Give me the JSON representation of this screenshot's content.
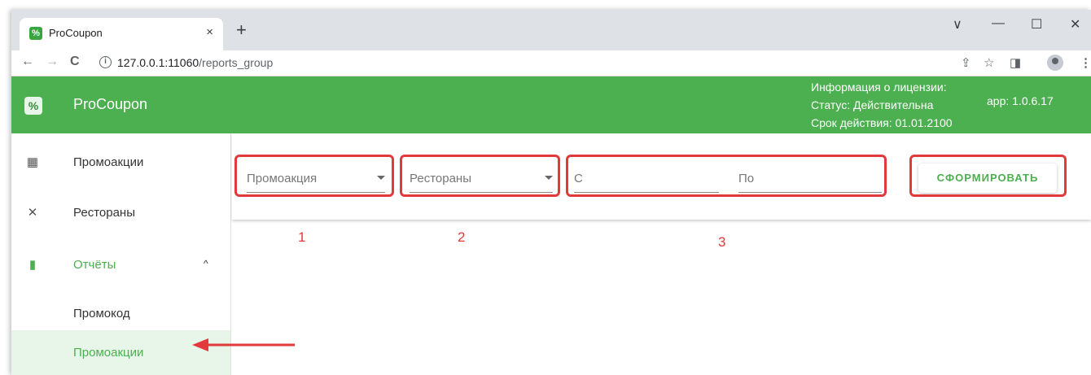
{
  "browser": {
    "tab_title": "ProCoupon",
    "tab_favicon": "%",
    "tab_close": "×",
    "new_tab": "+",
    "controls": [
      "∨",
      "—",
      "☐",
      "✕"
    ],
    "nav": {
      "back": "←",
      "forward": "→",
      "reload": "C"
    },
    "url_host": "127.0.0.1:11060",
    "url_path": "/reports_group",
    "toolbar_icons": [
      "share-icon",
      "star-icon",
      "sidepanel-icon",
      "profile-icon",
      "menu-icon"
    ]
  },
  "header": {
    "app_name": "ProCoupon",
    "logo": "%",
    "license_title": "Информация о лицензии:",
    "license_status": "Статус: Действительна",
    "license_expiry": "Срок действия: 01.01.2100",
    "version": "app: 1.0.6.17"
  },
  "sidebar": {
    "items": [
      {
        "label": "Промоакции",
        "icon": "ticket-icon",
        "glyph": "▦"
      },
      {
        "label": "Рестораны",
        "icon": "utensils-icon",
        "glyph": "✕"
      },
      {
        "label": "Отчёты",
        "icon": "bar-chart-icon",
        "glyph": "▮",
        "expanded": true,
        "chevron": "^"
      },
      {
        "label": "Промокод"
      },
      {
        "label": "Промоакции",
        "active": true
      }
    ]
  },
  "filters": {
    "promo_label": "Промоакция",
    "restaurants_label": "Рестораны",
    "date_from_label": "С",
    "date_to_label": "По",
    "build_button": "СФОРМИРОВАТЬ"
  },
  "annotations": {
    "numbers": [
      "1",
      "2",
      "3"
    ],
    "color": "#e23a3a"
  },
  "colors": {
    "brand": "#4caf50",
    "active_bg": "#e8f5e9"
  }
}
